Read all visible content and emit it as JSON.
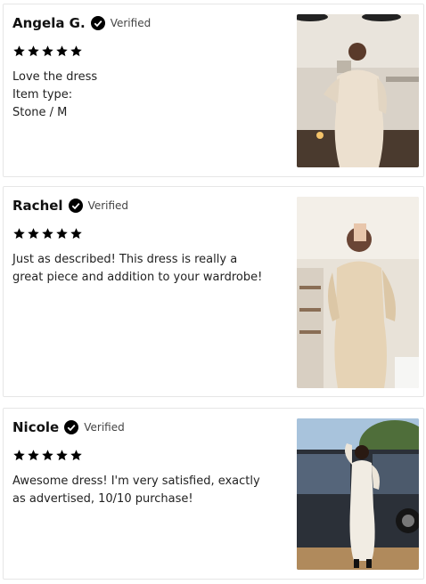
{
  "reviews": [
    {
      "name": "Angela G.",
      "verified": "Verified",
      "rating": 5,
      "text_lines": [
        "Love the dress",
        "Item type:",
        "Stone / M"
      ],
      "photo": "woman in stone ribbed dress, kitchen setting"
    },
    {
      "name": "Rachel",
      "verified": "Verified",
      "rating": 5,
      "text_lines": [
        "Just as described! This dress is really a",
        "great piece and addition to your wardrobe!"
      ],
      "photo": "woman in beige ribbed dress, room with shelves"
    },
    {
      "name": "Nicole",
      "verified": "Verified",
      "rating": 5,
      "text_lines": [
        "Awesome dress! I'm very satisfied, exactly",
        "as advertised, 10/10 purchase!"
      ],
      "photo": "woman in white ribbed dress next to dark car outdoors"
    }
  ],
  "colors": {
    "star": "#000000",
    "badge": "#000000",
    "card_border": "#e6e6e6"
  },
  "icons": {
    "verified": "check-circle-icon",
    "star": "star-icon"
  }
}
